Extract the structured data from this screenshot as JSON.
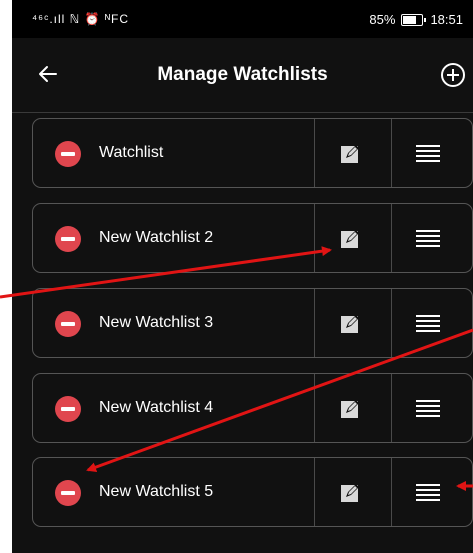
{
  "status_bar": {
    "left_text": "⁴⁶ᶜ.ıll ℕ ⏰ ᴺFC",
    "battery": "85%",
    "time": "18:51"
  },
  "header": {
    "title": "Manage Watchlists",
    "back_icon": "arrow-left-icon",
    "add_icon": "plus-circle-icon"
  },
  "watchlists": [
    {
      "name": "Watchlist"
    },
    {
      "name": "New Watchlist 2"
    },
    {
      "name": "New Watchlist 3"
    },
    {
      "name": "New Watchlist 4"
    },
    {
      "name": "New Watchlist 5"
    }
  ],
  "colors": {
    "background": "#111111",
    "remove": "#e0464e",
    "annotation_arrow": "#e11414"
  }
}
